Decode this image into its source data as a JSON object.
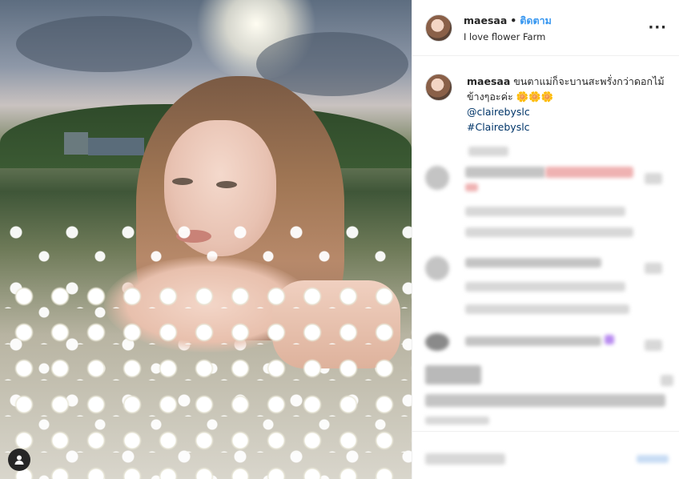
{
  "post": {
    "username": "maesaa",
    "separator": "•",
    "follow_label": "ติดตาม",
    "location": "I love flower Farm",
    "more_icon": "ellipsis-icon"
  },
  "caption": {
    "username": "maesaa",
    "text": "ขนตาแม่ก็จะบานสะพรั่งกว่าดอกไม้ข้างๆอะค่ะ 🌼🌼🌼",
    "mention": "@clairebyslc",
    "hashtag": "#Clairebyslc"
  },
  "colors": {
    "link": "#3897f0",
    "mention": "#003569",
    "text": "#262626"
  }
}
